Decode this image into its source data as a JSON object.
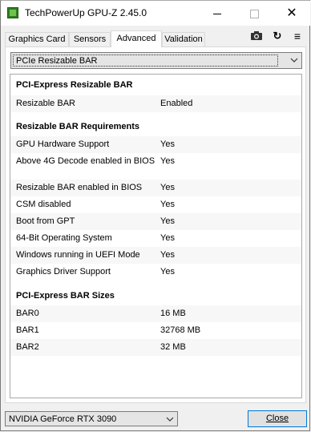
{
  "window": {
    "title": "TechPowerUp GPU-Z 2.45.0"
  },
  "titlebar_controls": {
    "minimize_icon": "minimize-icon",
    "maximize_icon": "maximize-icon",
    "close_icon": "close-icon",
    "close_glyph": "✕"
  },
  "tabs": [
    {
      "label": "Graphics Card",
      "active": false
    },
    {
      "label": "Sensors",
      "active": false
    },
    {
      "label": "Advanced",
      "active": true
    },
    {
      "label": "Validation",
      "active": false
    }
  ],
  "toolbar_icons": [
    "camera-icon",
    "refresh-icon",
    "menu-icon"
  ],
  "toolbar_glyphs": {
    "refresh": "↻",
    "menu": "≡"
  },
  "section_selector": {
    "value": "PCIe Resizable BAR"
  },
  "sections": {
    "pcie_bar": {
      "title": "PCI-Express Resizable BAR",
      "rows": [
        {
          "label": "Resizable BAR",
          "value": "Enabled"
        }
      ]
    },
    "requirements": {
      "title": "Resizable BAR Requirements",
      "rows": [
        {
          "label": "GPU Hardware Support",
          "value": "Yes"
        },
        {
          "label": "Above 4G Decode enabled in BIOS",
          "value": "Yes"
        },
        {
          "label": "Resizable BAR enabled in BIOS",
          "value": "Yes"
        },
        {
          "label": "CSM disabled",
          "value": "Yes"
        },
        {
          "label": "Boot from GPT",
          "value": "Yes"
        },
        {
          "label": "64-Bit Operating System",
          "value": "Yes"
        },
        {
          "label": "Windows running in UEFI Mode",
          "value": "Yes"
        },
        {
          "label": "Graphics Driver Support",
          "value": "Yes"
        }
      ]
    },
    "bar_sizes": {
      "title": "PCI-Express BAR Sizes",
      "rows": [
        {
          "label": "BAR0",
          "value": "16 MB"
        },
        {
          "label": "BAR1",
          "value": "32768 MB"
        },
        {
          "label": "BAR2",
          "value": "32 MB"
        }
      ]
    }
  },
  "gpu_selector": {
    "value": "NVIDIA GeForce RTX 3090"
  },
  "close_button": {
    "label": "Close"
  },
  "colors": {
    "accent": "#0078d7",
    "app_icon": "#2d7d1e"
  }
}
